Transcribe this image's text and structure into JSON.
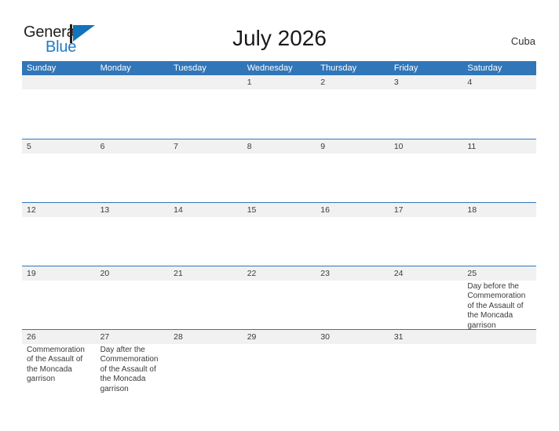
{
  "brand": {
    "word_one": "General",
    "word_two": "Blue",
    "mark_icon": "triangle-flag-icon"
  },
  "header": {
    "title": "July 2026",
    "region": "Cuba"
  },
  "calendar": {
    "weekdays": [
      "Sunday",
      "Monday",
      "Tuesday",
      "Wednesday",
      "Thursday",
      "Friday",
      "Saturday"
    ],
    "accent_color": "#3176b8",
    "band_color": "#f1f1f1",
    "weeks": [
      {
        "days": [
          {
            "num": "",
            "events": []
          },
          {
            "num": "",
            "events": []
          },
          {
            "num": "",
            "events": []
          },
          {
            "num": "1",
            "events": []
          },
          {
            "num": "2",
            "events": []
          },
          {
            "num": "3",
            "events": []
          },
          {
            "num": "4",
            "events": []
          }
        ]
      },
      {
        "days": [
          {
            "num": "5",
            "events": []
          },
          {
            "num": "6",
            "events": []
          },
          {
            "num": "7",
            "events": []
          },
          {
            "num": "8",
            "events": []
          },
          {
            "num": "9",
            "events": []
          },
          {
            "num": "10",
            "events": []
          },
          {
            "num": "11",
            "events": []
          }
        ]
      },
      {
        "days": [
          {
            "num": "12",
            "events": []
          },
          {
            "num": "13",
            "events": []
          },
          {
            "num": "14",
            "events": []
          },
          {
            "num": "15",
            "events": []
          },
          {
            "num": "16",
            "events": []
          },
          {
            "num": "17",
            "events": []
          },
          {
            "num": "18",
            "events": []
          }
        ]
      },
      {
        "days": [
          {
            "num": "19",
            "events": []
          },
          {
            "num": "20",
            "events": []
          },
          {
            "num": "21",
            "events": []
          },
          {
            "num": "22",
            "events": []
          },
          {
            "num": "23",
            "events": []
          },
          {
            "num": "24",
            "events": []
          },
          {
            "num": "25",
            "events": [
              "Day before the Commemoration of the Assault of the Moncada garrison"
            ]
          }
        ]
      },
      {
        "days": [
          {
            "num": "26",
            "events": [
              "Commemoration of the Assault of the Moncada garrison"
            ]
          },
          {
            "num": "27",
            "events": [
              "Day after the Commemoration of the Assault of the Moncada garrison"
            ]
          },
          {
            "num": "28",
            "events": []
          },
          {
            "num": "29",
            "events": []
          },
          {
            "num": "30",
            "events": []
          },
          {
            "num": "31",
            "events": []
          },
          {
            "num": "",
            "events": []
          }
        ]
      }
    ]
  }
}
